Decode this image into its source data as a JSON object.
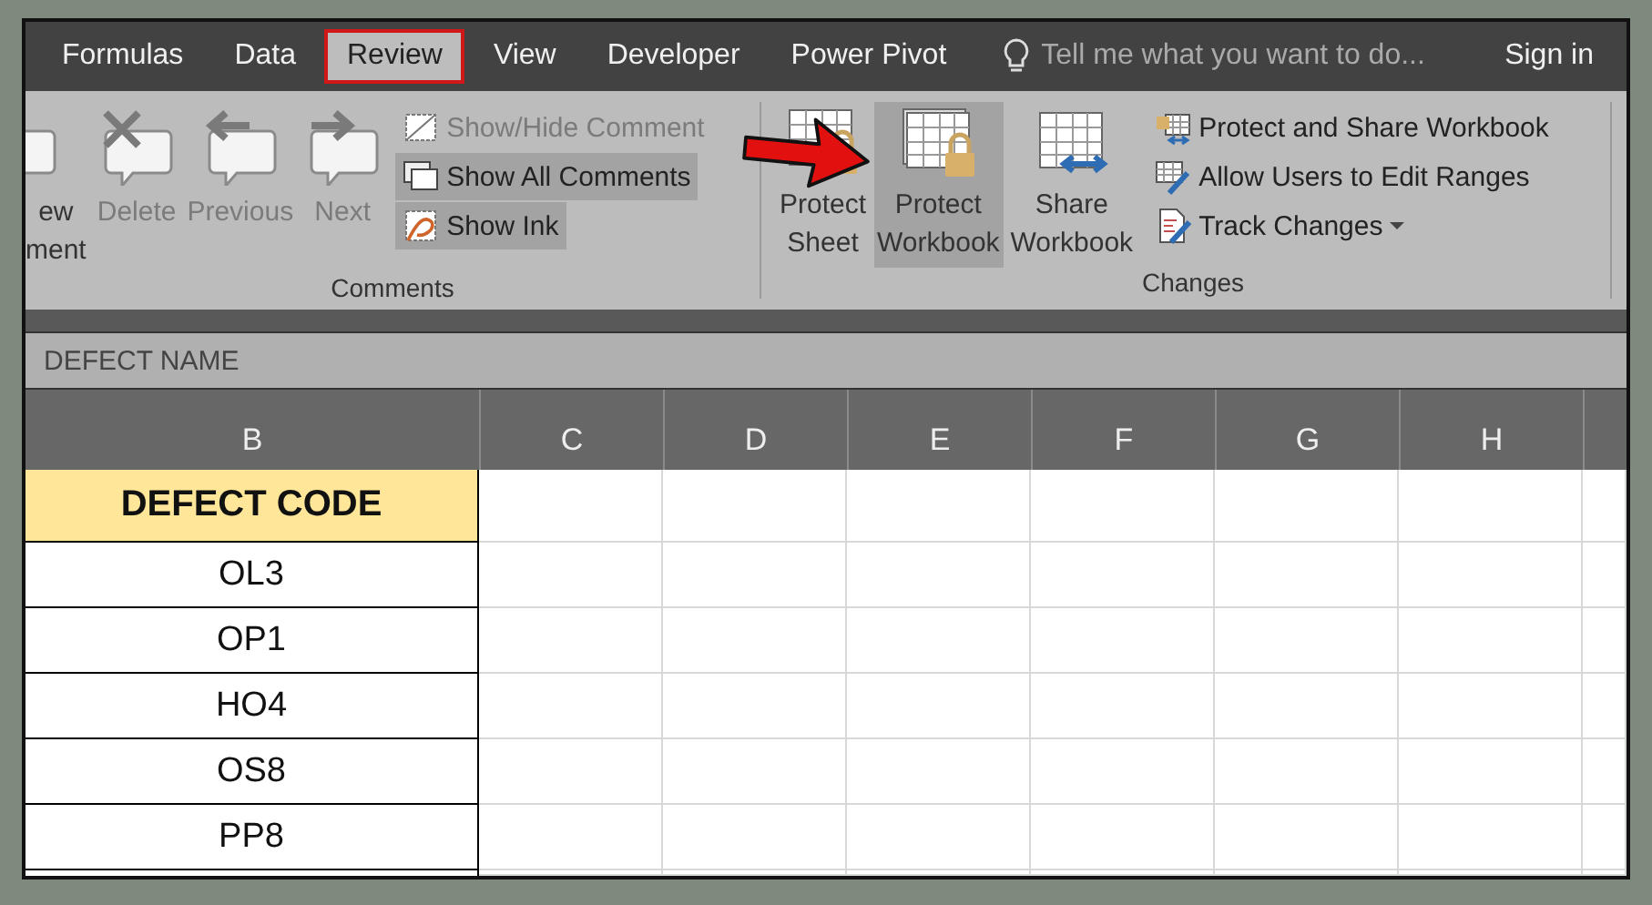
{
  "tabs": [
    {
      "label": "Formulas",
      "selected": false
    },
    {
      "label": "Data",
      "selected": false
    },
    {
      "label": "Review",
      "selected": true
    },
    {
      "label": "View",
      "selected": false
    },
    {
      "label": "Developer",
      "selected": false
    },
    {
      "label": "Power Pivot",
      "selected": false
    }
  ],
  "tell_me": {
    "placeholder": "Tell me what you want to do..."
  },
  "sign_in": "Sign in",
  "ribbon": {
    "groups": [
      {
        "label": "Comments",
        "large_buttons": [
          {
            "kind": "new-comment",
            "lines": [
              "ew",
              "ment"
            ],
            "disabled": false,
            "selected": false
          },
          {
            "kind": "delete-comment",
            "lines": [
              "Delete"
            ],
            "disabled": true,
            "selected": false
          },
          {
            "kind": "previous-comment",
            "lines": [
              "Previous"
            ],
            "disabled": true,
            "selected": false
          },
          {
            "kind": "next-comment",
            "lines": [
              "Next"
            ],
            "disabled": true,
            "selected": false
          }
        ],
        "small_buttons": [
          {
            "kind": "show-hide",
            "label": "Show/Hide Comment",
            "disabled": true,
            "selected": false,
            "has_menu": false
          },
          {
            "kind": "show-all",
            "label": "Show All Comments",
            "disabled": false,
            "selected": true,
            "has_menu": false
          },
          {
            "kind": "show-ink",
            "label": "Show Ink",
            "disabled": false,
            "selected": true,
            "has_menu": false
          }
        ]
      },
      {
        "label": "Changes",
        "large_buttons": [
          {
            "kind": "protect-sheet",
            "lines": [
              "Protect",
              "Sheet"
            ],
            "disabled": false,
            "selected": false
          },
          {
            "kind": "protect-workbook",
            "lines": [
              "Protect",
              "Workbook"
            ],
            "disabled": false,
            "selected": true
          },
          {
            "kind": "share-workbook",
            "lines": [
              "Share",
              "Workbook"
            ],
            "disabled": false,
            "selected": false
          }
        ],
        "small_buttons": [
          {
            "kind": "protect-share",
            "label": "Protect and Share Workbook",
            "disabled": false,
            "selected": false,
            "has_menu": false
          },
          {
            "kind": "allow-users",
            "label": "Allow Users to Edit Ranges",
            "disabled": false,
            "selected": false,
            "has_menu": false
          },
          {
            "kind": "track-changes",
            "label": "Track Changes",
            "disabled": false,
            "selected": false,
            "has_menu": true
          }
        ]
      }
    ]
  },
  "formula_bar": {
    "value": "DEFECT NAME"
  },
  "sheet": {
    "columns": [
      "B",
      "C",
      "D",
      "E",
      "F",
      "G",
      "H"
    ],
    "header_cell": "DEFECT CODE",
    "rows": [
      "OL3",
      "OP1",
      "HO4",
      "OS8",
      "PP8"
    ]
  }
}
